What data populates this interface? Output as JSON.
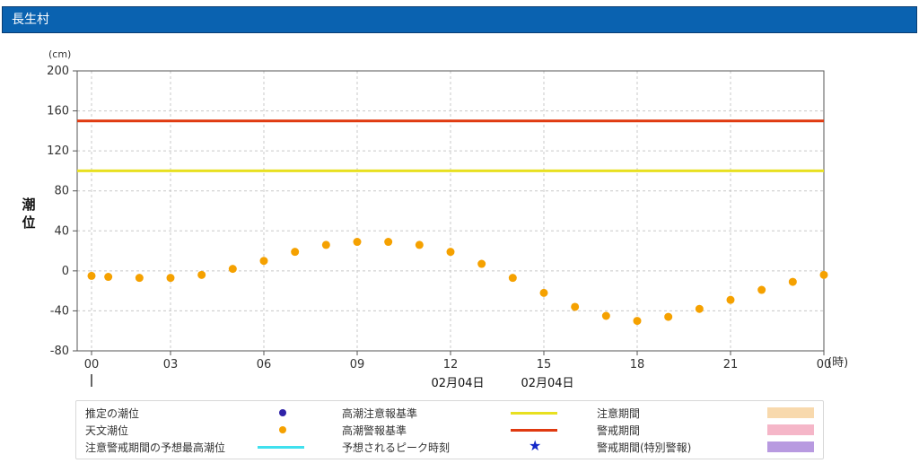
{
  "header": {
    "title": "長生村"
  },
  "chart_data": {
    "type": "scatter",
    "yunit": "(cm)",
    "ylabel": "潮\n位",
    "xunit": "(時)",
    "ylim": [
      -80,
      200
    ],
    "yticks": [
      -80,
      -40,
      0,
      40,
      80,
      120,
      160,
      200
    ],
    "xlim": [
      0,
      24
    ],
    "xticks": [
      0,
      3,
      6,
      9,
      12,
      15,
      18,
      21,
      24
    ],
    "xticklabels": [
      "00",
      "03",
      "06",
      "09",
      "12",
      "15",
      "18",
      "21",
      "00"
    ],
    "date_labels": [
      "02月04日",
      "02月04日"
    ],
    "grid": true,
    "series": [
      {
        "name": "天文潮位",
        "color": "#f5a100",
        "x": [
          0,
          1,
          2,
          3,
          4,
          5,
          6,
          7,
          8,
          9,
          10,
          11,
          12,
          13,
          14,
          15,
          16,
          17,
          18,
          19,
          20,
          21,
          22,
          23,
          24
        ],
        "y": [
          -5,
          -6,
          -7,
          -7,
          -4,
          2,
          10,
          19,
          26,
          29,
          29,
          26,
          19,
          7,
          -7,
          -22,
          -36,
          -45,
          -50,
          -46,
          -38,
          -29,
          -19,
          -11,
          -4
        ]
      }
    ],
    "thresholds": [
      {
        "name": "高潮注意報基準",
        "value": 100,
        "color": "#e8e020"
      },
      {
        "name": "高潮警報基準",
        "value": 150,
        "color": "#e03a10"
      }
    ]
  },
  "legend": {
    "items": [
      {
        "label": "推定の潮位",
        "mark": "dot",
        "color": "#2f22a8"
      },
      {
        "label": "高潮注意報基準",
        "mark": "line",
        "color": "#e8e020"
      },
      {
        "label": "注意期間",
        "mark": "box",
        "color": "#f8d9ad"
      },
      {
        "label": "天文潮位",
        "mark": "dot",
        "color": "#f5a100"
      },
      {
        "label": "高潮警報基準",
        "mark": "line",
        "color": "#e03a10"
      },
      {
        "label": "警戒期間",
        "mark": "box",
        "color": "#f5b6c8"
      },
      {
        "label": "注意警戒期間の予想最高潮位",
        "mark": "line",
        "color": "#40e0ee"
      },
      {
        "label": "予想されるピーク時刻",
        "mark": "star",
        "color": "#1328c8"
      },
      {
        "label": "警戒期間(特別警報)",
        "mark": "box",
        "color": "#b89ae0"
      }
    ]
  }
}
